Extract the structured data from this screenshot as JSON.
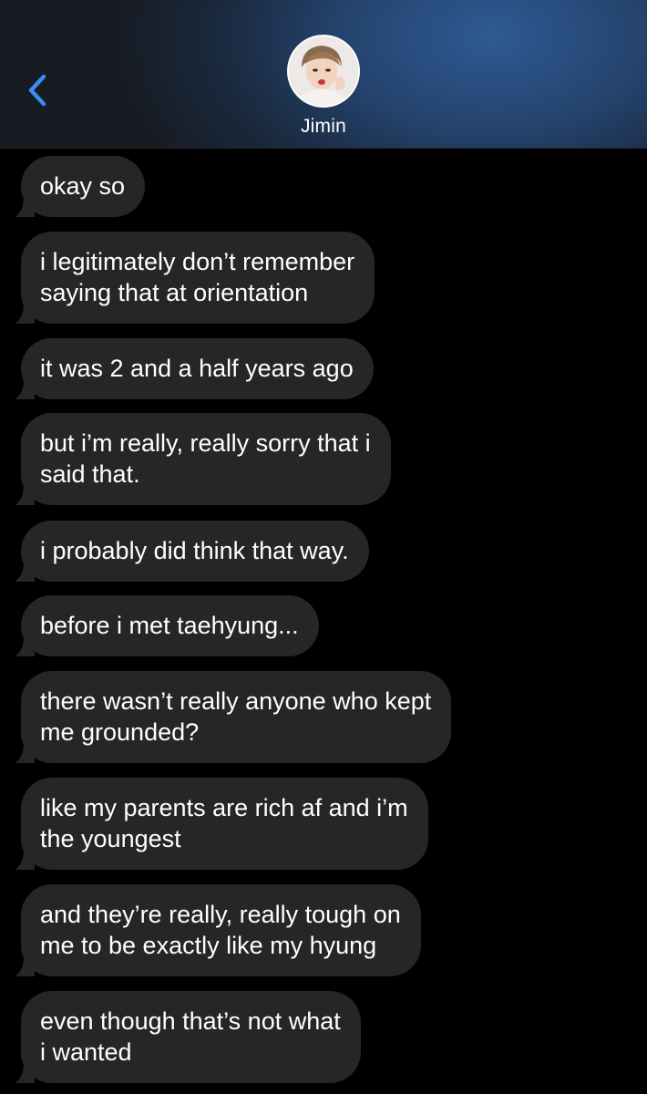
{
  "header": {
    "contact_name": "Jimin",
    "back_icon": "chevron-left-icon",
    "accent_color": "#3a8cf5"
  },
  "messages": [
    {
      "lines": [
        "okay so"
      ]
    },
    {
      "lines": [
        "i legitimately don’t remember",
        "saying that at orientation"
      ]
    },
    {
      "lines": [
        "it was 2 and a half years ago"
      ]
    },
    {
      "lines": [
        "but i’m really, really sorry that i",
        "said that."
      ]
    },
    {
      "lines": [
        "i probably did think that way."
      ]
    },
    {
      "lines": [
        "before i met taehyung..."
      ]
    },
    {
      "lines": [
        "there wasn’t really anyone who kept",
        "me grounded?"
      ]
    },
    {
      "lines": [
        "like my parents are rich af and i’m",
        "the youngest"
      ]
    },
    {
      "lines": [
        "and they’re really, really tough on",
        "me to be exactly like my hyung"
      ]
    },
    {
      "lines": [
        "even though that’s not what",
        "i wanted"
      ]
    }
  ]
}
